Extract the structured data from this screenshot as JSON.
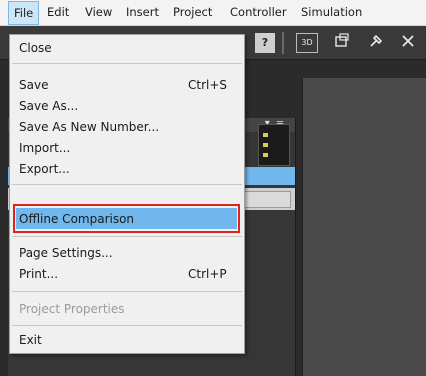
{
  "menubar": {
    "items": [
      {
        "label": "File"
      },
      {
        "label": "Edit"
      },
      {
        "label": "View"
      },
      {
        "label": "Insert"
      },
      {
        "label": "Project"
      },
      {
        "label": "Controller"
      },
      {
        "label": "Simulation"
      }
    ]
  },
  "toolbar": {
    "icons": [
      "help-icon",
      "3d-view-icon",
      "window-icon",
      "build-icon",
      "tools-icon"
    ],
    "labels": {
      "help": "?",
      "3d": "3D"
    }
  },
  "pane": {
    "header_controls": "▾ ╤"
  },
  "file_menu": {
    "items": [
      {
        "label": "Close",
        "shortcut": ""
      },
      {
        "label": "Save",
        "shortcut": "Ctrl+S"
      },
      {
        "label": "Save As...",
        "shortcut": ""
      },
      {
        "label": "Save As New Number...",
        "shortcut": ""
      },
      {
        "label": "Import...",
        "shortcut": ""
      },
      {
        "label": "Export...",
        "shortcut": ""
      },
      {
        "label": "Offline Comparison",
        "shortcut": ""
      },
      {
        "label": "Page Settings...",
        "shortcut": ""
      },
      {
        "label": "Print...",
        "shortcut": "Ctrl+P"
      },
      {
        "label": "Project Properties",
        "shortcut": "",
        "disabled": true
      },
      {
        "label": "Exit",
        "shortcut": ""
      }
    ]
  },
  "colors": {
    "highlight_border": "#e0241c",
    "selection": "#6fb7ec"
  }
}
